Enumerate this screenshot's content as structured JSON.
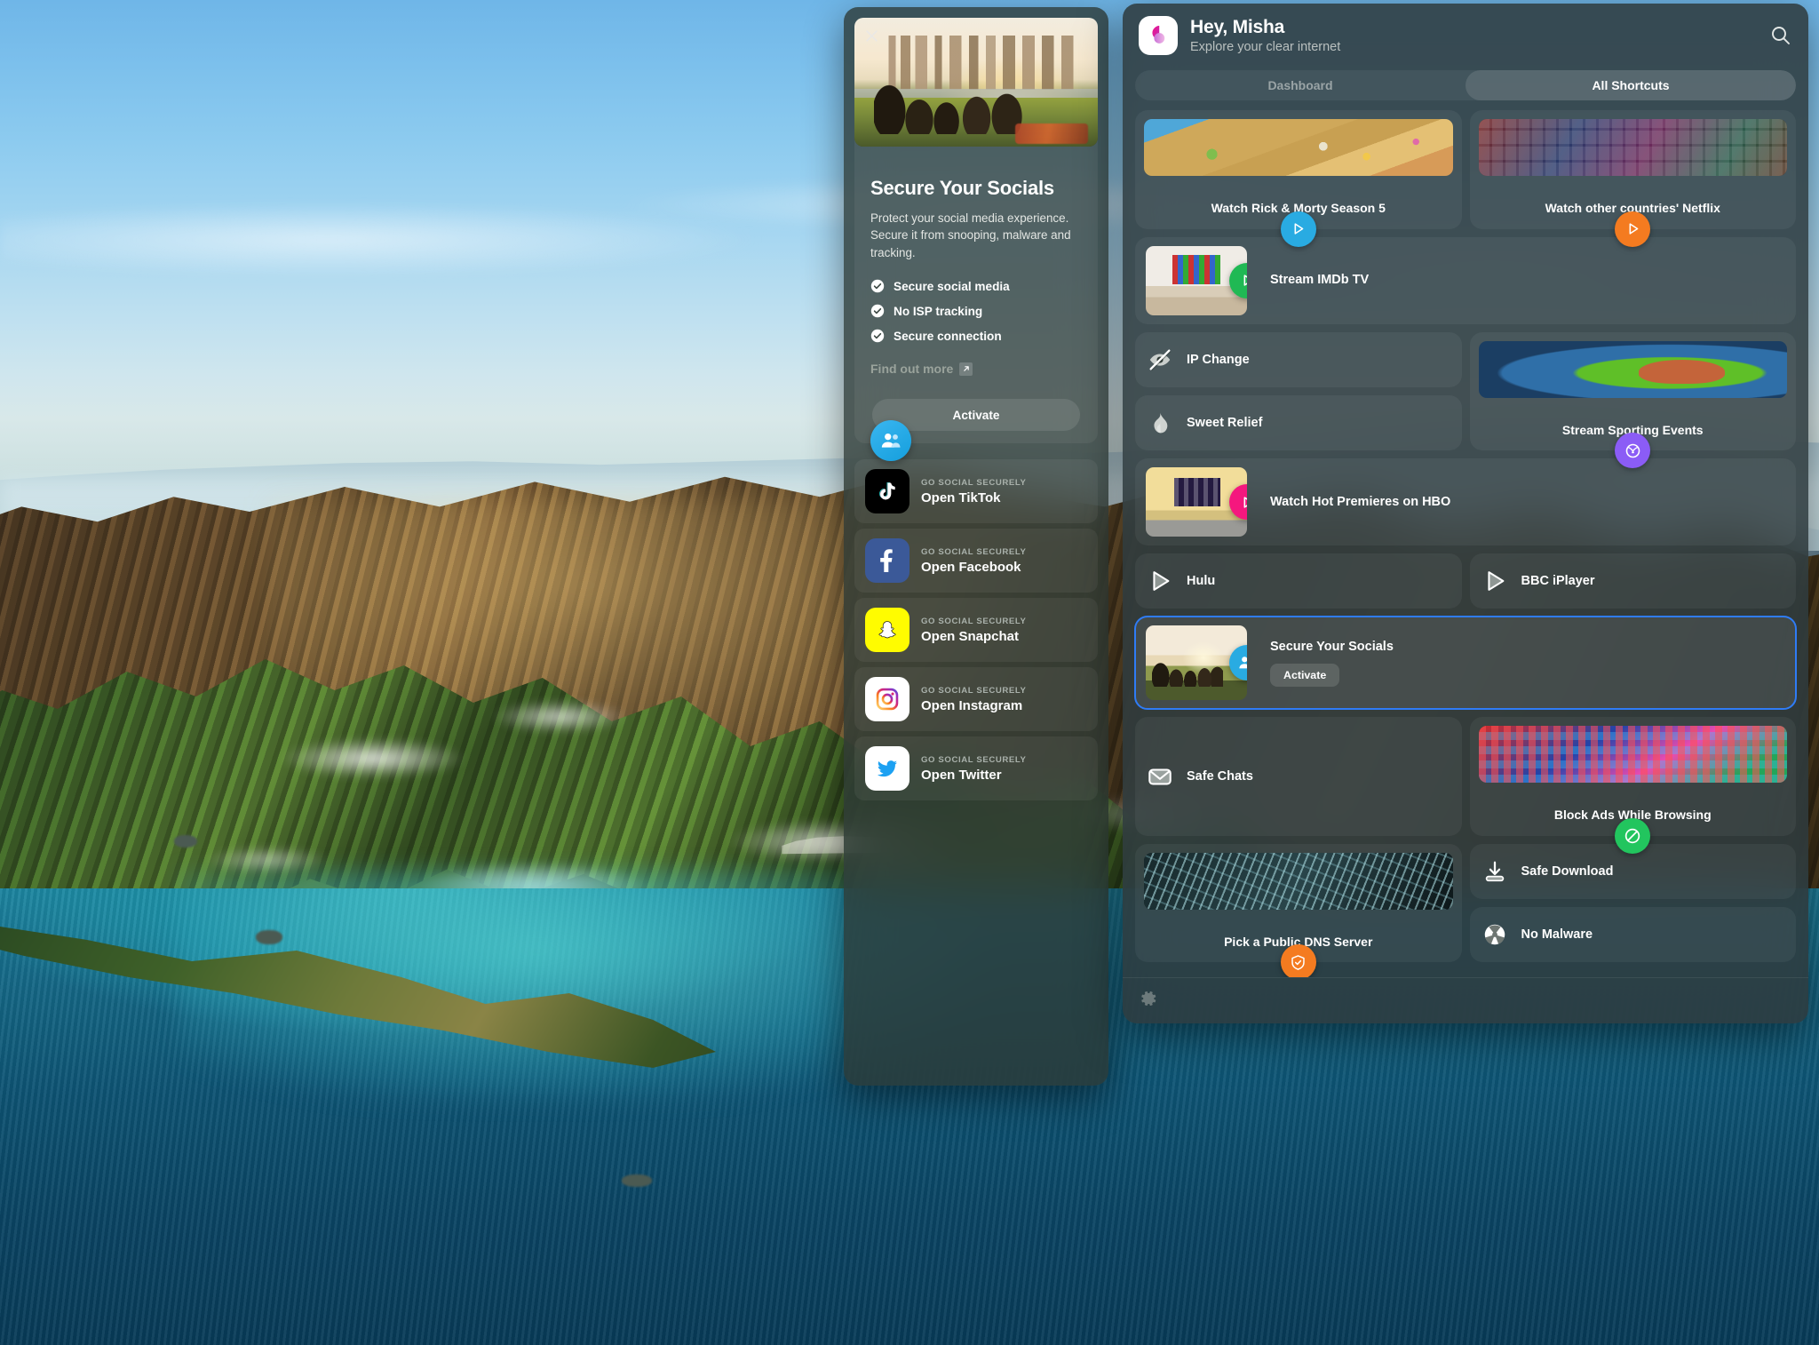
{
  "detail": {
    "close_icon": "close-icon",
    "badge_icon": "people-icon",
    "title": "Secure Your Socials",
    "description": "Protect your social media experience. Secure it from snooping, malware and tracking.",
    "features": [
      {
        "icon": "check-circle-icon",
        "label": "Secure social media"
      },
      {
        "icon": "check-circle-icon",
        "label": "No ISP tracking"
      },
      {
        "icon": "check-circle-icon",
        "label": "Secure connection"
      }
    ],
    "find_out_more": "Find out more",
    "external_link_icon": "external-link-icon",
    "activate_label": "Activate",
    "social_shortcuts": [
      {
        "kicker": "GO SOCIAL SECURELY",
        "title": "Open TikTok",
        "icon": "tiktok-icon",
        "bg": "#000000"
      },
      {
        "kicker": "GO SOCIAL SECURELY",
        "title": "Open Facebook",
        "icon": "facebook-icon",
        "bg": "#3b5998"
      },
      {
        "kicker": "GO SOCIAL SECURELY",
        "title": "Open Snapchat",
        "icon": "snapchat-icon",
        "bg": "#FFFC00"
      },
      {
        "kicker": "GO SOCIAL SECURELY",
        "title": "Open Instagram",
        "icon": "instagram-icon",
        "bg": "#ffffff"
      },
      {
        "kicker": "GO SOCIAL SECURELY",
        "title": "Open Twitter",
        "icon": "twitter-icon",
        "bg": "#ffffff"
      }
    ]
  },
  "sidebar": {
    "logo_icon": "clearvpn-logo-icon",
    "greeting": "Hey, Misha",
    "tagline": "Explore your clear internet",
    "search_icon": "search-icon",
    "tabs": [
      {
        "label": "Dashboard",
        "active": false
      },
      {
        "label": "All Shortcuts",
        "active": true
      }
    ],
    "shortcuts": [
      {
        "id": "watch-rick-and-morty",
        "label": "Watch Rick & Morty Season 5",
        "layout": "tall",
        "thumb": "art-rickmorty",
        "fab_icon": "play-icon",
        "fab_color": "#29ABE2"
      },
      {
        "id": "watch-other-netflix",
        "label": "Watch other countries' Netflix",
        "layout": "tall",
        "thumb": "art-netflix",
        "fab_icon": "play-icon",
        "fab_color": "#F47B20"
      },
      {
        "id": "stream-imdb-tv",
        "label": "Stream IMDb TV",
        "layout": "wide-img",
        "thumb": "art-room-white",
        "fab_icon": "play-icon",
        "fab_color": "#20B954"
      },
      {
        "id": "ip-change",
        "label": "IP Change",
        "layout": "row",
        "icon": "eye-slash-icon"
      },
      {
        "id": "stream-sporting",
        "label": "Stream Sporting Events",
        "layout": "tall-tall",
        "thumb": "art-stadium",
        "fab_icon": "tennis-ball-icon",
        "fab_color": "#8B5CF6"
      },
      {
        "id": "sweet-relief",
        "label": "Sweet Relief",
        "layout": "row",
        "icon": "flame-icon"
      },
      {
        "id": "watch-hbo",
        "label": "Watch Hot Premieres on HBO",
        "layout": "wide-img",
        "thumb": "art-room-yellow",
        "fab_icon": "play-icon",
        "fab_color": "#F5177E"
      },
      {
        "id": "hulu",
        "label": "Hulu",
        "layout": "row",
        "icon": "play-outline-icon"
      },
      {
        "id": "bbc-iplayer",
        "label": "BBC iPlayer",
        "layout": "row",
        "icon": "play-outline-icon"
      },
      {
        "id": "secure-your-socials",
        "label": "Secure Your Socials",
        "layout": "selected",
        "thumb": "art-picnic",
        "fab_icon": "people-icon",
        "fab_color": "#29ABE2",
        "action_label": "Activate",
        "selected": true
      },
      {
        "id": "safe-chats",
        "label": "Safe Chats",
        "layout": "row",
        "icon": "envelope-icon"
      },
      {
        "id": "block-ads",
        "label": "Block Ads While Browsing",
        "layout": "tall",
        "thumb": "art-times",
        "fab_icon": "block-icon",
        "fab_color": "#22C55E"
      },
      {
        "id": "pick-dns",
        "label": "Pick a Public DNS Server",
        "layout": "tall",
        "thumb": "art-circuit",
        "fab_icon": "shield-check-icon",
        "fab_color": "#F47B20"
      },
      {
        "id": "safe-download",
        "label": "Safe Download",
        "layout": "row",
        "icon": "download-icon"
      },
      {
        "id": "no-malware",
        "label": "No Malware",
        "layout": "row",
        "icon": "radiation-icon"
      }
    ],
    "footer_icon": "gear-icon"
  },
  "colors": {
    "selection_blue": "#2f7cf6",
    "panel_bg": "#2d3a3e",
    "accent_pink": "#E91E8C"
  }
}
